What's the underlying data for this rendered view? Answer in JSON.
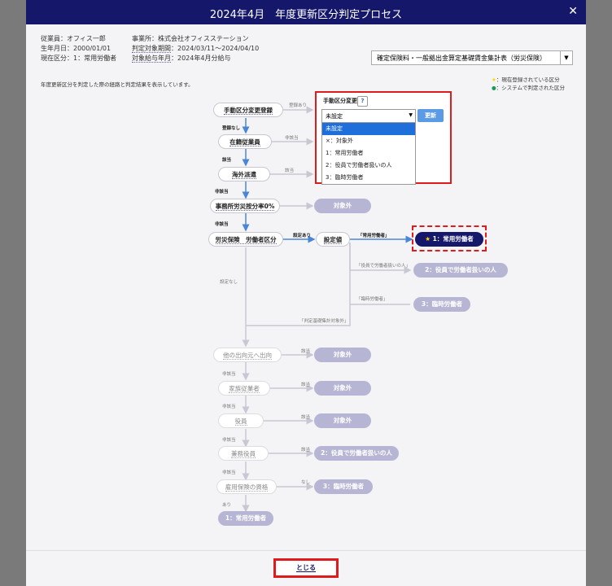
{
  "title": "2024年4月　年度更新区分判定プロセス",
  "info": {
    "employee": "従業員：オフィス一郎",
    "birthdate": "生年月日：2000/01/01",
    "current_class": "現在区分：1：常用労働者",
    "office": "事業所：株式会社オフィスステーション",
    "period_label": "判定対象期間",
    "period_value": "：2024/03/11～2024/04/10",
    "salary_label": "対象給与年月",
    "salary_value": "：2024年4月分給与"
  },
  "report_select": "確定保険料・一般拠出金算定基礎賃金集計表（労災保険）",
  "description": "年度更新区分を判定した際の経路と判定結果を表示しています。",
  "legend": {
    "current": "：現在登録されている区分",
    "system": "：システムで判定された区分"
  },
  "nodes": {
    "manual": "手動区分変更登録",
    "enrolled": "在籍従業員",
    "overseas": "海外派遣",
    "ratio": "事務所労災按分率0%",
    "workclass": "労災保険　労働者区分",
    "setvalue": "設定値",
    "secondment": "他の出向元へ出向",
    "family": "家族従業者",
    "officer": "役員",
    "concurrent": "兼務役員",
    "qualification": "雇用保険の資格",
    "regular_bottom": "1：常用労働者"
  },
  "results": {
    "exempt": "対象外",
    "regular": "1：常用労働者",
    "officer_treated": "2：役員で労働者扱いの人",
    "temp": "3：臨時労働者"
  },
  "edge_labels": {
    "registered": "登録あり",
    "not_registered": "登録なし",
    "applicable": "該当",
    "not_applicable": "非該当",
    "has_setting": "設定あり",
    "no_setting": "設定なし",
    "q_regular": "「常用労働者」",
    "q_officer": "「役員で労働者扱いの人」",
    "q_temp": "「臨時労働者」",
    "q_judgement": "「判定基礎集計対象外」",
    "none": "なし",
    "exists": "あり"
  },
  "popup": {
    "header": "手動区分変更",
    "help": "?",
    "selected": "未設定",
    "update_button": "更新",
    "options": [
      "未設定",
      "×：対象外",
      "1：常用労働者",
      "2：役員で労働者扱いの人",
      "3：臨時労働者"
    ]
  },
  "close_button": "とじる",
  "colors": {
    "title_bar": "#14176a",
    "result_node": "#b6b6d4",
    "current_node": "#14176a",
    "highlight": "#e01b1b",
    "update_button": "#5b9be6",
    "dropdown_selected": "#1e6fd9"
  }
}
